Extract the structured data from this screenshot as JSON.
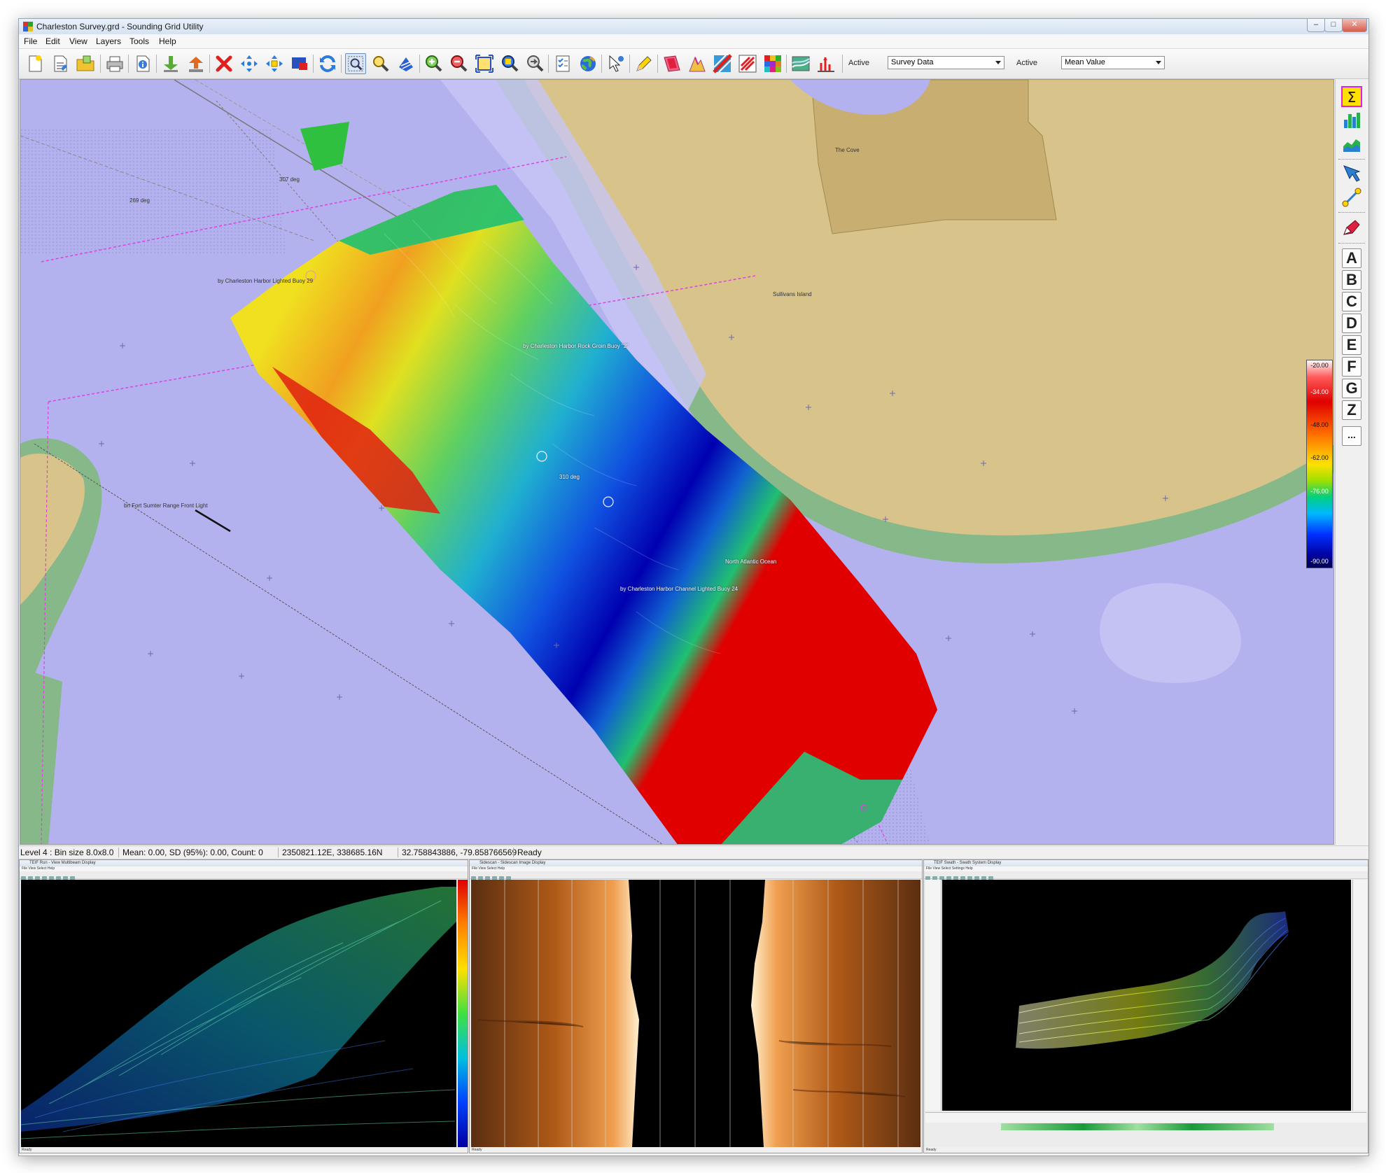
{
  "window": {
    "title": "Charleston Survey.grd - Sounding Grid Utility",
    "controls": [
      "–",
      "□",
      "✕"
    ]
  },
  "menu": [
    "File",
    "Edit",
    "View",
    "Layers",
    "Tools",
    "Help"
  ],
  "toolbar": {
    "active_label_1": "Active",
    "active_select_1": "Survey Data",
    "active_label_2": "Active",
    "active_select_2": "Mean Value",
    "icons": [
      "new-icon",
      "open-icon",
      "folder-icon",
      "print-icon",
      "info-icon",
      "import-icon",
      "export-icon",
      "delete-icon",
      "pan-arrows-icon",
      "move-arrows-icon",
      "screen-red-icon",
      "refresh-icon",
      "zoom-box-icon",
      "magnify-icon",
      "world-grid-icon",
      "zoom-in-icon",
      "zoom-out-icon",
      "zoom-extents-icon",
      "zoom-window-icon",
      "zoom-prev-icon",
      "checklist-icon",
      "globe-icon",
      "pointer-icon",
      "pencil-tool-icon",
      "palette-red-icon",
      "shade-icon",
      "stripe-icon",
      "grid-red-icon",
      "color-grid-icon",
      "contour-icon",
      "spike-icon"
    ],
    "colors": {
      "accent": "#6d8fbd"
    }
  },
  "map": {
    "labels": {
      "deg307": "307 deg",
      "deg269": "269 deg",
      "buoy29": "by Charleston Harbor Lighted Buoy 29",
      "rockgroin": "by Charleston Harbor Rock Groin Buoy \"2\"",
      "deg310": "310 deg",
      "fortsumter": "bn Fort Sumter Range Front Light",
      "northatlantic": "North Atlantic Ocean",
      "channelbuoy": "by Charleston Harbor Channel Lighted Buoy 24",
      "thecove": "The Cove",
      "sullivans": "Sullivans Island"
    },
    "colors": {
      "water": "#b3b2ef",
      "land": "#d8c48a",
      "shoal": "#86b88a",
      "track": "#e040e0"
    }
  },
  "legend": {
    "values": [
      "-20.00",
      "-34.00",
      "-48.00",
      "-62.00",
      "-76.00",
      "-90.00"
    ],
    "colors": [
      "#ffffff",
      "#e00000",
      "#ffe000",
      "#00b8ff",
      "#0000a0"
    ]
  },
  "right_toolbar": {
    "icons": [
      "sigma-icon",
      "histogram-icon",
      "area-chart-icon",
      "fan-beam-icon",
      "profile-node-icon",
      "ink-pen-icon"
    ],
    "letters": [
      "A",
      "B",
      "C",
      "D",
      "E",
      "F",
      "G",
      "Z",
      "..."
    ]
  },
  "status": {
    "level": "Level 4 : Bin size 8.0x8.0",
    "stats": "Mean: 0.00, SD (95%): 0.00, Count: 0",
    "grid_coords": "2350821.12E, 338685.16N",
    "geo_coords": "32.758843886,  -79.858766569",
    "state": "Ready"
  },
  "panels": {
    "multibeam": {
      "title": "TEIF Run - View Multibeam Display",
      "status": "Ready"
    },
    "sidescan": {
      "title": "Sidescan - Sidescan Image Display",
      "status": "Ready"
    },
    "swath": {
      "title": "TEIF Swath - Swath System Display",
      "status": "Ready"
    }
  }
}
